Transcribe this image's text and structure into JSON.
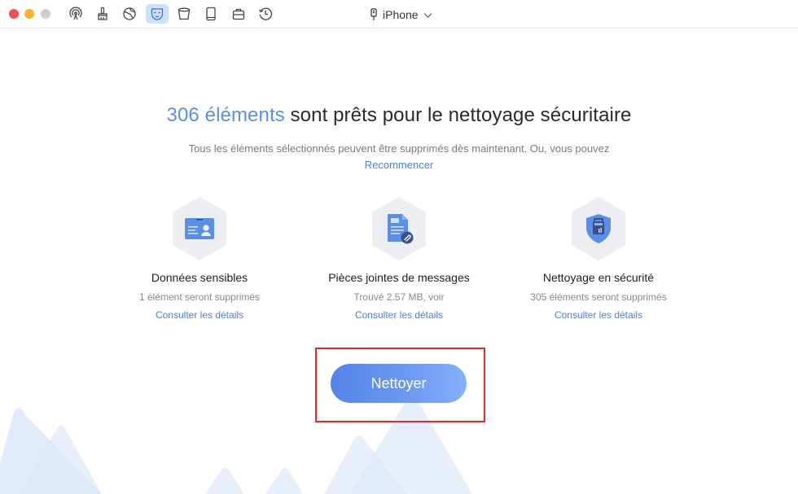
{
  "window": {
    "traffic_lights": [
      "close",
      "minimize",
      "maximize"
    ]
  },
  "toolbar": {
    "tools": [
      {
        "name": "airbackup",
        "icon": "airplay-signal-icon",
        "active": false
      },
      {
        "name": "cleaner",
        "icon": "brush-icon",
        "active": false
      },
      {
        "name": "browser",
        "icon": "globe-icon",
        "active": false
      },
      {
        "name": "privacy",
        "icon": "mask-icon",
        "active": true
      },
      {
        "name": "trash",
        "icon": "bin-icon",
        "active": false
      },
      {
        "name": "device",
        "icon": "tablet-icon",
        "active": false
      },
      {
        "name": "toolkit",
        "icon": "briefcase-icon",
        "active": false
      },
      {
        "name": "history",
        "icon": "history-clock-icon",
        "active": false
      }
    ],
    "device_name": "iPhone"
  },
  "main": {
    "headline_count": "306 éléments",
    "headline_rest": " sont prêts pour le nettoyage sécuritaire",
    "subtext": "Tous les éléments sélectionnés peuvent être supprimés dès maintenant. Ou, vous pouvez",
    "restart_link": "Recommencer",
    "cards": [
      {
        "title": "Données sensibles",
        "desc": "1 élément seront supprimés",
        "link": "Consulter les détails",
        "icon": "id-card-icon"
      },
      {
        "title": "Pièces jointes de messages",
        "desc": "Trouvé 2.57 MB, voir",
        "link": "Consulter les détails",
        "icon": "attachment-doc-icon"
      },
      {
        "title": "Nettoyage en sécurité",
        "desc": "305 éléments seront supprimés",
        "link": "Consulter les détails",
        "icon": "shield-shredder-icon"
      }
    ],
    "clean_button": "Nettoyer"
  },
  "colors": {
    "accent": "#5b8fe6",
    "link": "#4a7fe0",
    "highlight_border": "#e8281c",
    "button_start": "#5483ea",
    "button_end": "#86b0fb"
  }
}
